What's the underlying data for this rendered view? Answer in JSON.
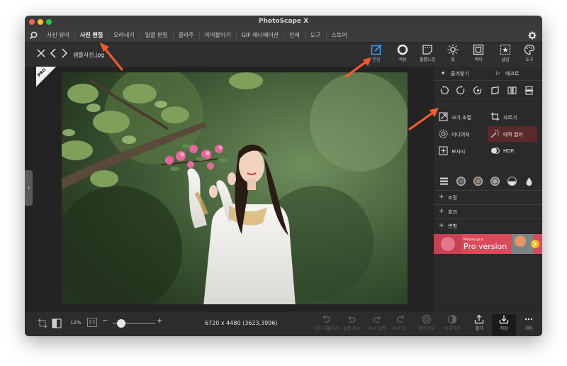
{
  "window": {
    "title": "PhotoScape X"
  },
  "menu": {
    "items": [
      "사진 뷰어",
      "사진 편집",
      "오려내기",
      "일괄 편집",
      "콜라주",
      "이어붙이기",
      "GIF 애니메이션",
      "인쇄",
      "도구",
      "스토어"
    ],
    "active": "사진 편집"
  },
  "toolbar": {
    "filename": "샘플사진.jpg",
    "tools": [
      "편집",
      "색상",
      "필름느낌",
      "빛",
      "액자",
      "삽입",
      "도구"
    ],
    "active_tool": "편집"
  },
  "canvas": {
    "pro_badge": "PRO",
    "expand_glyph": "›"
  },
  "panel": {
    "favorites": "즐겨찾기",
    "macro": "매크로",
    "features": [
      "크기 조절",
      "자르기",
      "미니어처",
      "매직 컬러",
      "보사시",
      "HDR"
    ],
    "sections": [
      "조정",
      "효과",
      "변형"
    ],
    "promo_small": "PhotoScape X",
    "promo_text": "Pro version",
    "star_glyph": "★",
    "play_glyph": "▷",
    "plus_glyph": "+"
  },
  "status": {
    "zoom": "12%",
    "zoom_ratio": "1:1",
    "zoom_level": 0.2,
    "minus": "−",
    "plus": "+",
    "dimensions": "6720 x 4480 (3623,3996)",
    "actions": [
      "모두 되돌리기",
      "실행 취소",
      "다시 실행",
      "다시 실...",
      "원본 비교",
      "비교하기",
      "열기",
      "저장",
      "기타"
    ]
  },
  "colors": {
    "accent": "#3aa0ff",
    "annotation_arrow": "#ff5a2a"
  }
}
